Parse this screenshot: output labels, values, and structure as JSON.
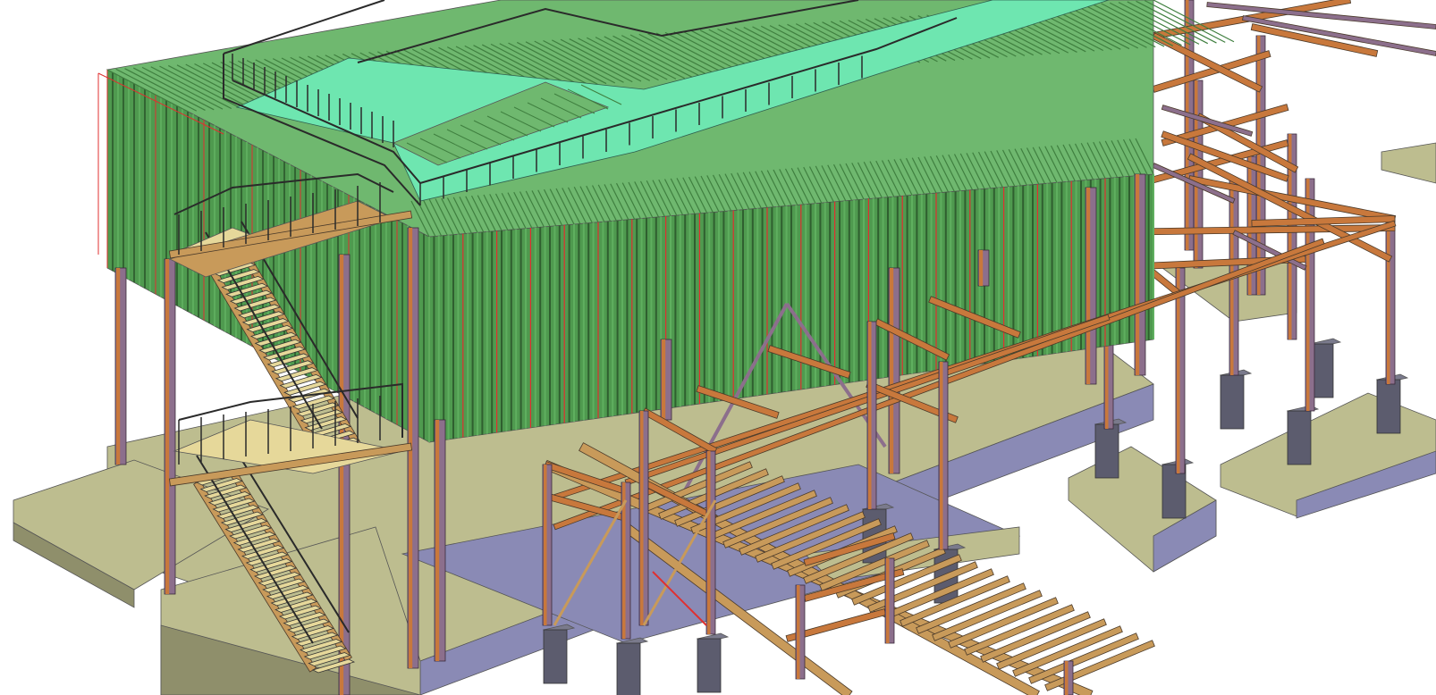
{
  "app": {
    "view_type": "isometric 3D model viewport",
    "background_color": "#ffffff"
  },
  "scene": {
    "description": "",
    "colors": {
      "concrete_top": "#bdbd8f",
      "concrete_side": "#8f8f6b",
      "concrete_edge": "#6f6f50",
      "slab_base_side": "#8a8ab5",
      "pier": "#5c5c6e",
      "column": "#8c6f8c",
      "beam_orange": "#c8783c",
      "beam_tan": "#c89a5a",
      "cladding_dark": "#2f5f2f",
      "cladding_mid": "#4f9a4f",
      "cladding_light": "#6fb86f",
      "roof_deck": "#6ee6b0",
      "railing": "#2a2a2a",
      "stair_tread": "#e6d89a",
      "red_line": "#e03030"
    }
  }
}
